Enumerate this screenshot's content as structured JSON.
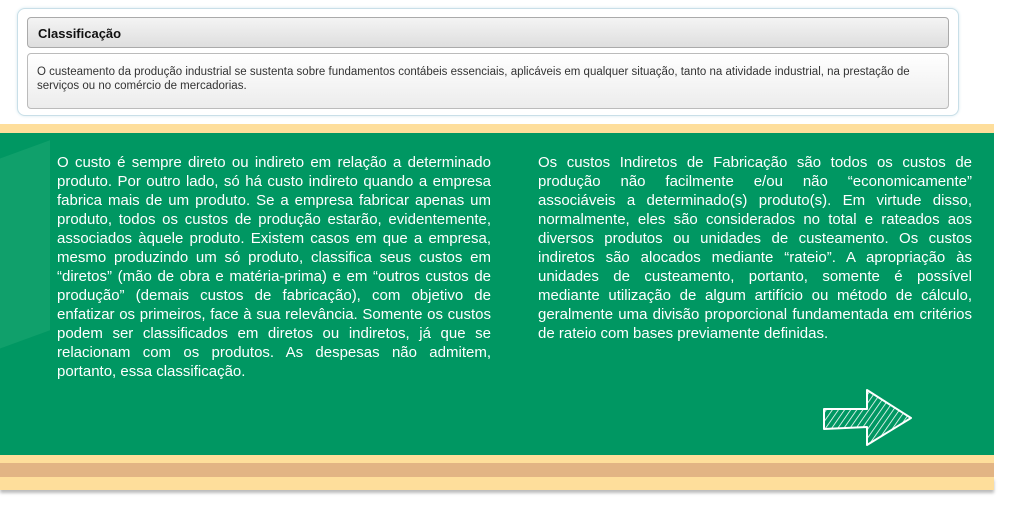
{
  "panel": {
    "title": "Classificação",
    "description": "O custeamento da produção industrial se sustenta sobre fundamentos contábeis essenciais, aplicáveis em qualquer situação, tanto na atividade industrial, na prestação de serviços ou no comércio de mercadorias."
  },
  "content": {
    "left": "O custo é sempre direto ou indireto em relação a determinado produto. Por outro lado, só há custo indireto quando a empresa fabrica mais de um produto. Se a empresa fabricar apenas um produto, todos os custos de produção estarão, evidentemente, associados àquele produto. Existem casos em que a empresa, mesmo produzindo um só produto, classifica seus custos em “diretos” (mão de obra e matéria-prima) e em “outros custos de produção” (demais custos de fabricação), com objetivo de enfatizar os primeiros, face à sua relevância. Somente os custos podem ser classificados em diretos ou indiretos, já que se relacionam com os produtos. As despesas não admitem, portanto, essa classificação.",
    "right": "Os custos Indiretos de Fabricação são todos os custos de produção não facilmente e/ou não “economicamente” associáveis a determinado(s) produto(s). Em virtude disso, normalmente, eles são considerados no total e rateados aos diversos produtos ou unidades de custeamento. Os custos indiretos são alocados mediante “rateio”. A apropriação às unidades de custeamento, portanto, somente é possível mediante utilização de algum artifício ou método de cálculo, geralmente uma divisão proporcional fundamentada em critérios de rateio com bases previamente definidas."
  },
  "colors": {
    "green": "#009762",
    "stripe_light": "#fede9b",
    "stripe_dark": "#e2b484"
  }
}
